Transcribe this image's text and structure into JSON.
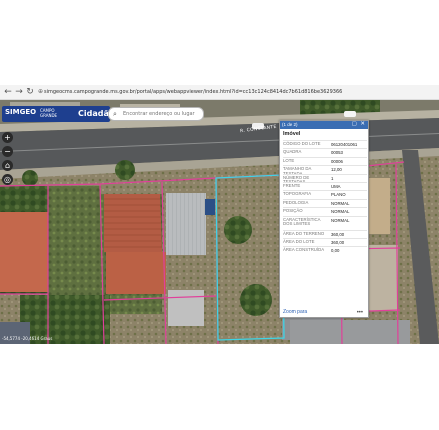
{
  "browser": {
    "back_icon": "back-arrow-icon",
    "forward_icon": "forward-arrow-icon",
    "reload_icon": "reload-icon",
    "url": "simgeocms.campogrande.ms.gov.br/portal/apps/webappviewer/index.html?id=cc13c124c8414dc7b61d816be3629366"
  },
  "header": {
    "logo_text": "SIMGEO",
    "logo_sub": "CAMPO GRANDE",
    "app_name": "Cidadão",
    "search_placeholder": "Encontrar endereço ou lugar"
  },
  "controls": {
    "zoom_in": "+",
    "zoom_out": "−",
    "home_icon": "home-icon",
    "locate_icon": "locate-icon"
  },
  "map": {
    "street_name": "R. CONSTANTE"
  },
  "popup": {
    "pager": "(1 de 2)",
    "actions": "▢ ✕",
    "title": "Imóvel",
    "rows": [
      {
        "key": "CÓDIGO DO LOTE",
        "value": "06120401061"
      },
      {
        "key": "QUADRA",
        "value": "00053"
      },
      {
        "key": "LOTE",
        "value": "00006"
      },
      {
        "key": "TAMANHO DA TESTADA",
        "value": "12,00"
      },
      {
        "key": "NÚMERO DE TESTADAS",
        "value": "1"
      },
      {
        "key": "FRENTE",
        "value": "UMA"
      },
      {
        "key": "TOPOGRAFIA",
        "value": "PLANO"
      },
      {
        "key": "PEDOLOGIA",
        "value": "NORMAL"
      },
      {
        "key": "POSIÇÃO",
        "value": "NORMAL"
      },
      {
        "key": "CARACTERÍSTICA DOS LIMITES",
        "value": "NORMAL"
      },
      {
        "key": "ÁREA DO TERRENO",
        "value": "360,00"
      },
      {
        "key": "ÁREA DO LOTE",
        "value": "360,00"
      },
      {
        "key": "ÁREA CONSTRUÍDA",
        "value": "0,00"
      }
    ],
    "zoom_link": "Zoom para",
    "more": "•••"
  },
  "footer": {
    "coords": "-54,5774 -20,4614 Graus"
  },
  "colors": {
    "header_blue": "#1e3f8f",
    "popup_header": "#3a6db3",
    "lot_lines": "#e0409a",
    "selection": "#3dd5e6"
  }
}
